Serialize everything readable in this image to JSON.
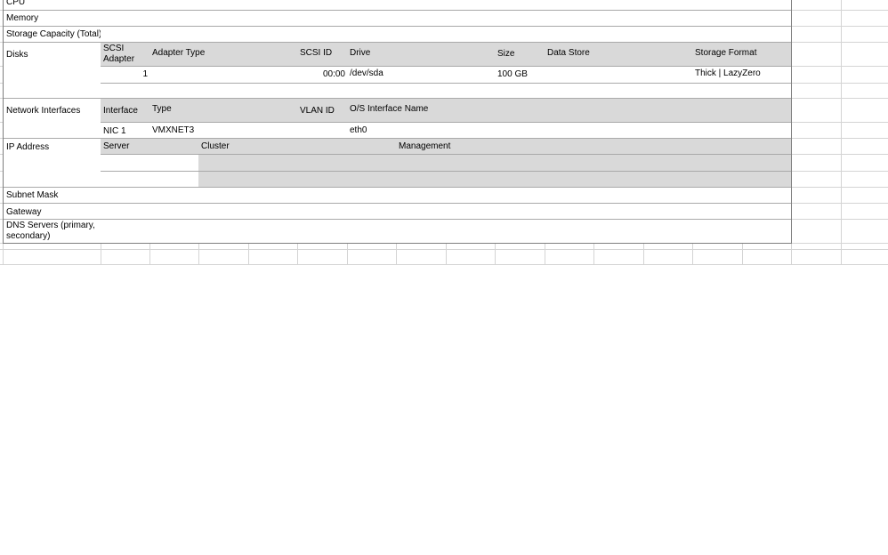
{
  "labels": {
    "cpu": "CPU",
    "memory": "Memory",
    "storage": "Storage Capacity (Total)",
    "disks": "Disks",
    "network": "Network Interfaces",
    "ip": "IP Address",
    "subnet": "Subnet Mask",
    "gateway": "Gateway",
    "dns": "DNS Servers (primary, secondary)"
  },
  "disks": {
    "headers": {
      "scsi_adapter": "SCSI Adapter",
      "adapter_type": "Adapter Type",
      "scsi_id": "SCSI ID",
      "drive": "Drive",
      "size": "Size",
      "data_store": "Data Store",
      "storage_format": "Storage Format"
    },
    "rows": [
      {
        "scsi_adapter": "1",
        "adapter_type": "",
        "scsi_id": "00:00",
        "drive": "/dev/sda",
        "size": "100 GB",
        "data_store": "",
        "storage_format": "Thick | LazyZero"
      }
    ]
  },
  "network": {
    "headers": {
      "interface": "Interface",
      "type": "Type",
      "vlan_id": "VLAN ID",
      "os_name": "O/S Interface Name"
    },
    "rows": [
      {
        "interface": "NIC 1",
        "type": "VMXNET3",
        "vlan_id": "",
        "os_name": "eth0"
      }
    ]
  },
  "ip": {
    "headers": {
      "server": "Server",
      "cluster": "Cluster",
      "management": "Management"
    }
  },
  "colors": {
    "header_fill": "#d9d9d9",
    "grid_line": "#d4d4d4",
    "cell_border": "#a9a9a9"
  }
}
